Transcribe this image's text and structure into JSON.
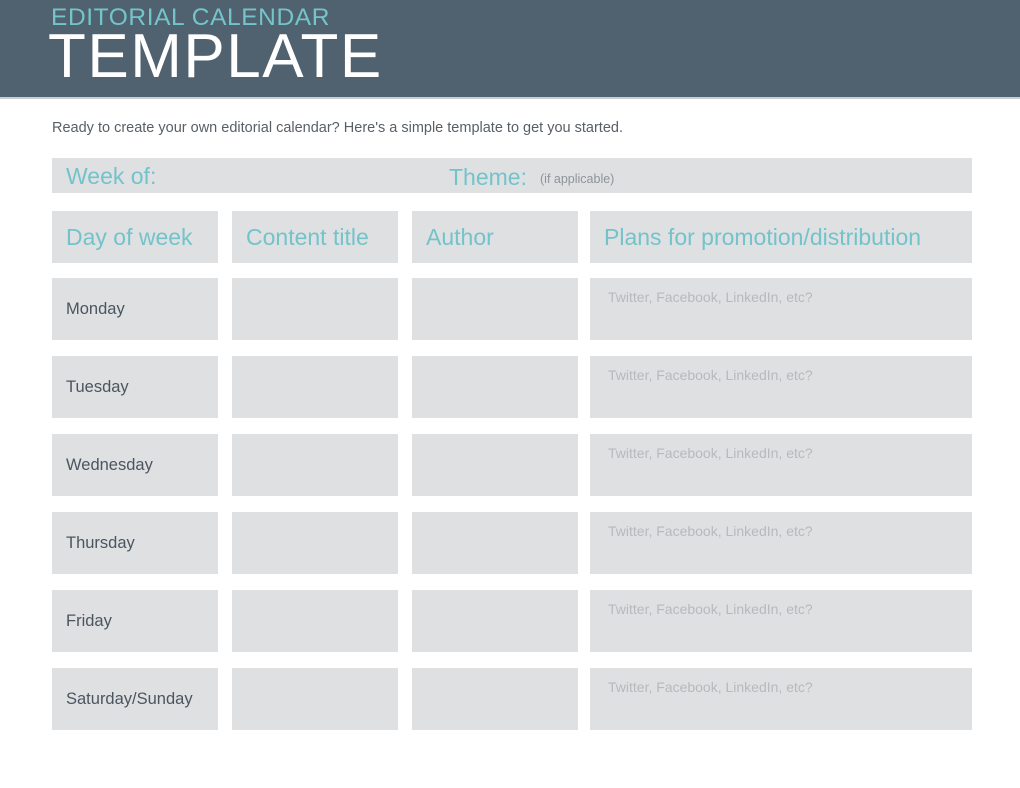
{
  "header": {
    "eyebrow": "EDITORIAL CALENDAR",
    "title": "TEMPLATE",
    "background_color": "#50626F",
    "eyebrow_color": "#74C4CB",
    "title_color": "#FFFFFF"
  },
  "intro": {
    "text": "Ready to create your own editorial calendar? Here's a simple template to get you started."
  },
  "week_bar": {
    "week_of_label": "Week of:",
    "week_of_value": "",
    "theme_label": "Theme:",
    "theme_note": "(if applicable)",
    "theme_value": ""
  },
  "table": {
    "columns": [
      {
        "label": "Day of week"
      },
      {
        "label": "Content title"
      },
      {
        "label": "Author"
      },
      {
        "label": "Plans for promotion/distribution"
      }
    ],
    "promotion_placeholder": "Twitter, Facebook, LinkedIn, etc?",
    "rows": [
      {
        "day": "Monday",
        "content_title": "",
        "author": "",
        "promotion": ""
      },
      {
        "day": "Tuesday",
        "content_title": "",
        "author": "",
        "promotion": ""
      },
      {
        "day": "Wednesday",
        "content_title": "",
        "author": "",
        "promotion": ""
      },
      {
        "day": "Thursday",
        "content_title": "",
        "author": "",
        "promotion": ""
      },
      {
        "day": "Friday",
        "content_title": "",
        "author": "",
        "promotion": ""
      },
      {
        "day": "Saturday/Sunday",
        "content_title": "",
        "author": "",
        "promotion": ""
      }
    ]
  },
  "theme_colors": {
    "accent_teal": "#73C3CA",
    "cell_gray": "#DFE0E2",
    "text_dark": "#4B5560",
    "placeholder_gray": "#B6BABD",
    "header_slate": "#50626F"
  }
}
